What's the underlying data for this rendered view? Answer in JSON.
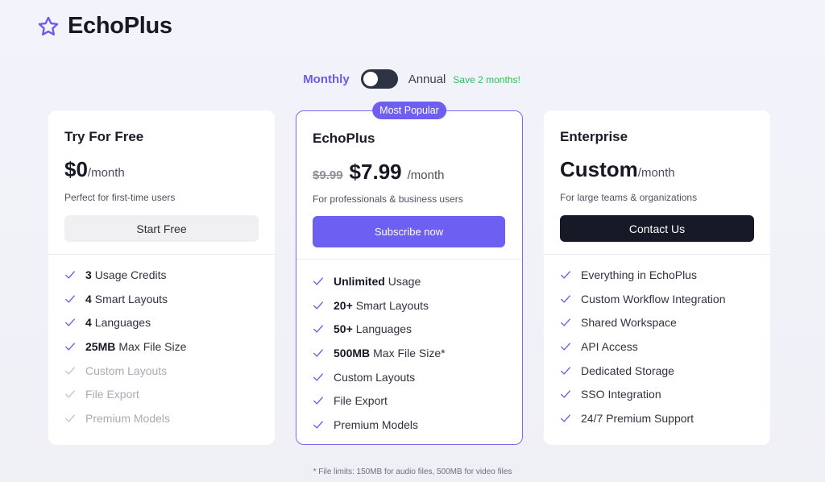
{
  "brand": {
    "name": "EchoPlus",
    "icon": "star-icon",
    "accent": "#6b5ce7"
  },
  "billing": {
    "monthly_label": "Monthly",
    "annual_label": "Annual",
    "save_note": "Save 2 months!",
    "toggle_annual": false
  },
  "plans": [
    {
      "name": "Try For Free",
      "price": "$0",
      "per": "/month",
      "description": "Perfect for first-time users",
      "cta": "Start Free",
      "features": [
        {
          "bold": "3",
          "text": "Usage Credits",
          "enabled": true
        },
        {
          "bold": "4",
          "text": "Smart Layouts",
          "enabled": true
        },
        {
          "bold": "4",
          "text": "Languages",
          "enabled": true
        },
        {
          "bold": "25MB",
          "text": "Max File Size",
          "enabled": true
        },
        {
          "bold": "",
          "text": "Custom Layouts",
          "enabled": false
        },
        {
          "bold": "",
          "text": "File Export",
          "enabled": false
        },
        {
          "bold": "",
          "text": "Premium Models",
          "enabled": false
        }
      ]
    },
    {
      "name": "EchoPlus",
      "badge": "Most Popular",
      "old_price": "$9.99",
      "price": "$7.99",
      "per": "/month",
      "description": "For professionals & business users",
      "cta": "Subscribe now",
      "features": [
        {
          "bold": "Unlimited",
          "text": "Usage",
          "enabled": true
        },
        {
          "bold": "20+",
          "text": "Smart Layouts",
          "enabled": true
        },
        {
          "bold": "50+",
          "text": "Languages",
          "enabled": true
        },
        {
          "bold": "500MB",
          "text": "Max File Size*",
          "enabled": true
        },
        {
          "bold": "",
          "text": "Custom Layouts",
          "enabled": true
        },
        {
          "bold": "",
          "text": "File Export",
          "enabled": true
        },
        {
          "bold": "",
          "text": "Premium Models",
          "enabled": true
        }
      ]
    },
    {
      "name": "Enterprise",
      "price": "Custom",
      "per": "/month",
      "description": "For large teams & organizations",
      "cta": "Contact Us",
      "features": [
        {
          "bold": "",
          "text": "Everything in EchoPlus",
          "enabled": true
        },
        {
          "bold": "",
          "text": "Custom Workflow Integration",
          "enabled": true
        },
        {
          "bold": "",
          "text": "Shared Workspace",
          "enabled": true
        },
        {
          "bold": "",
          "text": "API Access",
          "enabled": true
        },
        {
          "bold": "",
          "text": "Dedicated Storage",
          "enabled": true
        },
        {
          "bold": "",
          "text": "SSO Integration",
          "enabled": true
        },
        {
          "bold": "",
          "text": "24/7 Premium Support",
          "enabled": true
        }
      ]
    }
  ],
  "footnote": "* File limits: 150MB for audio files, 500MB for video files",
  "colors": {
    "check_enabled": "#6b5ce7",
    "check_disabled": "#c2c4cc",
    "primary_button": "#6d5ff2",
    "dark_button": "#161a27"
  }
}
